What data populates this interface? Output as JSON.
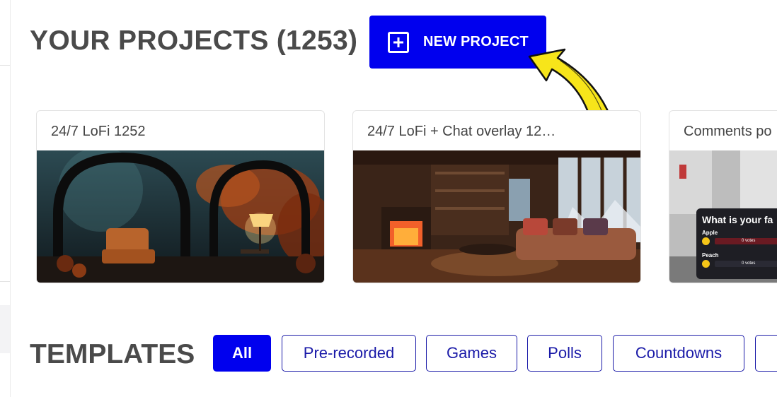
{
  "header": {
    "title": "YOUR PROJECTS (1253)",
    "new_project_label": "NEW PROJECT"
  },
  "projects": [
    {
      "title": "24/7 LoFi 1252"
    },
    {
      "title": "24/7 LoFi + Chat overlay 12…"
    },
    {
      "title": "Comments po",
      "poll": {
        "question": "What is your fa",
        "options": [
          {
            "label": "Apple",
            "votes": "0 votes"
          },
          {
            "label": "Peach",
            "votes": "0 votes"
          }
        ]
      }
    }
  ],
  "templates": {
    "title": "TEMPLATES",
    "filters": [
      "All",
      "Pre-recorded",
      "Games",
      "Polls",
      "Countdowns"
    ],
    "active_filter": "All"
  },
  "colors": {
    "accent": "#0000ee",
    "chip_border": "#1a1aa8",
    "arrow": "#f7e51a"
  }
}
